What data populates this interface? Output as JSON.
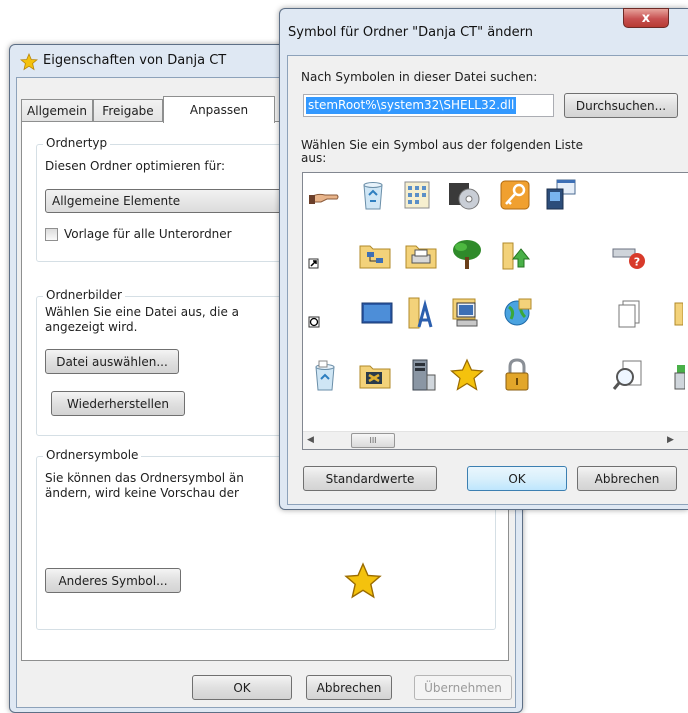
{
  "props_dialog": {
    "title": "Eigenschaften von Danja CT",
    "tabs": [
      "Allgemein",
      "Freigabe",
      "Anpassen"
    ],
    "active_tab": "Anpassen",
    "folder_type": {
      "group_title": "Ordnertyp",
      "optimize_label": "Diesen Ordner optimieren für:",
      "dropdown_value": "Allgemeine Elemente",
      "template_checkbox_label": "Vorlage für alle Unterordner",
      "template_checked": false
    },
    "folder_pictures": {
      "group_title": "Ordnerbilder",
      "description_line1": "Wählen Sie eine Datei aus, die a",
      "description_line2": "angezeigt wird.",
      "choose_file_button": "Datei auswählen...",
      "restore_button": "Wiederherstellen"
    },
    "folder_icons": {
      "group_title": "Ordnersymbole",
      "description_line1": "Sie können das Ordnersymbol än",
      "description_line2": "ändern, wird keine Vorschau der",
      "change_icon_button": "Anderes Symbol..."
    },
    "buttons": {
      "ok": "OK",
      "cancel": "Abbrechen",
      "apply": "Übernehmen"
    }
  },
  "icon_dialog": {
    "title": "Symbol für Ordner \"Danja CT\" ändern",
    "close_glyph": "x",
    "file_label": "Nach Symbolen in dieser Datei suchen:",
    "file_value": "stemRoot%\\system32\\SHELL32.dll",
    "browse_button": "Durchsuchen...",
    "list_label_line1": "Wählen Sie ein Symbol aus der folgenden Liste",
    "list_label_line2": "aus:",
    "scroll_thumb_glyph": "III",
    "buttons": {
      "defaults": "Standardwerte",
      "ok": "OK",
      "cancel": "Abbrechen"
    },
    "icons": [
      "hand-share-icon",
      "recycle-bin-empty-icon",
      "control-panel-icon",
      "media-disc-icon",
      "key-icon",
      "window-computer-icon",
      "partial-icon",
      "shortcut-arrow-icon",
      "folder-network-icon",
      "folder-printer-icon",
      "tree-icon",
      "folder-up-icon",
      "drive-help-icon",
      "clock-overlay-icon",
      "desktop-monitor-icon",
      "folder-text-icon",
      "computer-icon",
      "globe-icon",
      "documents-icon",
      "partial-folder-icon",
      "recycle-bin-full-icon",
      "folder-tools-icon",
      "server-icon",
      "star-icon",
      "padlock-icon",
      "search-document-icon",
      "partial-green-icon"
    ]
  },
  "colors": {
    "selection": "#3399ff",
    "close_button": "#c75050",
    "star": "#f4c20d"
  }
}
